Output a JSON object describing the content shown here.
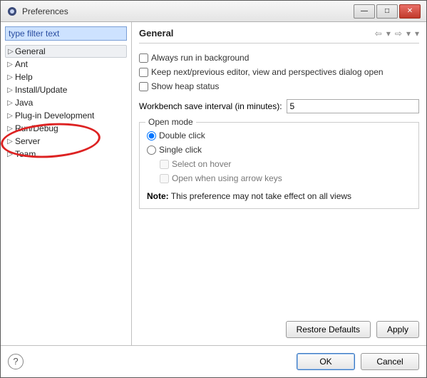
{
  "window": {
    "title": "Preferences"
  },
  "filter": {
    "placeholder": "type filter text"
  },
  "tree": {
    "items": [
      {
        "label": "General"
      },
      {
        "label": "Ant"
      },
      {
        "label": "Help"
      },
      {
        "label": "Install/Update"
      },
      {
        "label": "Java"
      },
      {
        "label": "Plug-in Development"
      },
      {
        "label": "Run/Debug"
      },
      {
        "label": "Server"
      },
      {
        "label": "Team"
      }
    ]
  },
  "page": {
    "title": "General",
    "checks": {
      "always_bg": "Always run in background",
      "keep_next": "Keep next/previous editor, view and perspectives dialog open",
      "show_heap": "Show heap status"
    },
    "interval_label": "Workbench save interval (in minutes):",
    "interval_value": "5",
    "openmode": {
      "legend": "Open mode",
      "double": "Double click",
      "single": "Single click",
      "select_hover": "Select on hover",
      "open_arrow": "Open when using arrow keys"
    },
    "note_label": "Note:",
    "note_text": "This preference may not take effect on all views"
  },
  "buttons": {
    "restore": "Restore Defaults",
    "apply": "Apply",
    "ok": "OK",
    "cancel": "Cancel"
  }
}
